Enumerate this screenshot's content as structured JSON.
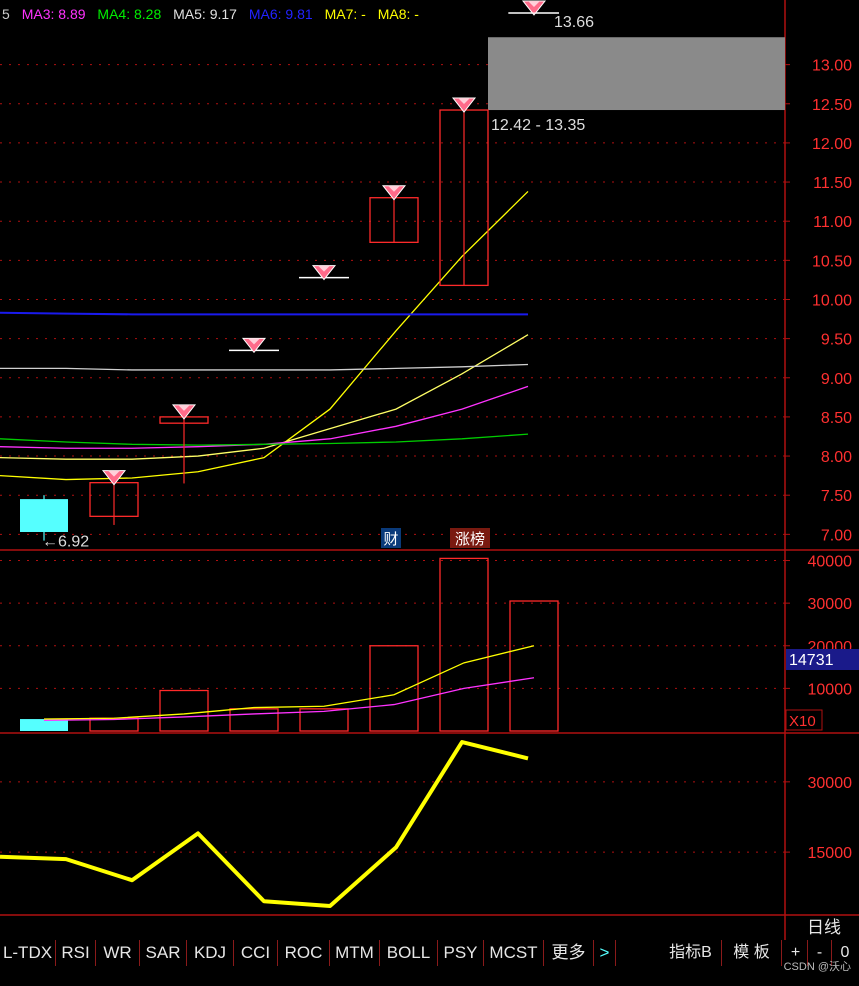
{
  "legend": {
    "left_fragment": "5",
    "items": [
      {
        "name": "MA3",
        "value": "8.89",
        "color": "#ff33ff"
      },
      {
        "name": "MA4",
        "value": "8.28",
        "color": "#00ee00"
      },
      {
        "name": "MA5",
        "value": "9.17",
        "color": "#e0e0e0"
      },
      {
        "name": "MA6",
        "value": "9.81",
        "color": "#2222ff"
      },
      {
        "name": "MA7",
        "value": "-",
        "color": "#ffff00"
      },
      {
        "name": "MA8",
        "value": "-",
        "color": "#ffff00"
      }
    ]
  },
  "colors": {
    "up": "#ff2a2a",
    "down": "#55ffff",
    "grid": "#b01010",
    "ma_fast": "#ffff00",
    "ma_mid": "#ffff66",
    "ma_magenta": "#ff33ff",
    "ma_green": "#00cc00",
    "ma_white": "#cfcfcf",
    "ma_blue": "#1a1aee",
    "highlight_box": "#8a8a8a",
    "indicator": "#ffff00"
  },
  "annotations": {
    "high_label": "13.66",
    "low_label": "6.92",
    "range_label": "12.42 - 13.35",
    "badge_finance": "财",
    "badge_limitup": "涨榜"
  },
  "volume_panel": {
    "current_value": "14731",
    "multiplier": "X10"
  },
  "period_label": "日线",
  "tabs": [
    "L-TDX",
    "RSI",
    "WR",
    "SAR",
    "KDJ",
    "CCI",
    "ROC",
    "MTM",
    "BOLL",
    "PSY",
    "MCST",
    "更多",
    ">"
  ],
  "right_tabs": [
    "指标B",
    "模 板",
    "+",
    "-",
    "0"
  ],
  "watermark": "CSDN @沃心",
  "chart_data": [
    {
      "type": "candlestick",
      "y_ticks": [
        "7.00",
        "7.50",
        "8.00",
        "8.50",
        "9.00",
        "9.50",
        "10.00",
        "10.50",
        "11.00",
        "11.50",
        "12.00",
        "12.50",
        "13.00"
      ],
      "ylim": [
        6.8,
        13.8
      ],
      "candles": [
        {
          "open": 7.45,
          "close": 7.03,
          "high": 7.5,
          "low": 6.92,
          "dir": "down"
        },
        {
          "open": 7.23,
          "close": 7.66,
          "high": 7.66,
          "low": 7.12,
          "dir": "up"
        },
        {
          "open": 8.42,
          "close": 8.5,
          "high": 8.5,
          "low": 7.65,
          "dir": "up"
        },
        {
          "open": 9.35,
          "close": 9.35,
          "high": 9.35,
          "low": 9.35,
          "dir": "up"
        },
        {
          "open": 10.28,
          "close": 10.28,
          "high": 10.28,
          "low": 10.28,
          "dir": "up"
        },
        {
          "open": 10.73,
          "close": 11.3,
          "high": 11.3,
          "low": 10.73,
          "dir": "up"
        },
        {
          "open": 10.18,
          "close": 12.42,
          "high": 12.42,
          "low": 10.18,
          "dir": "up"
        },
        {
          "open": 13.66,
          "close": 13.66,
          "high": 13.66,
          "low": 13.66,
          "dir": "up"
        }
      ],
      "ma_lines": [
        {
          "name": "MA-yellow-fast",
          "values": [
            7.75,
            7.7,
            7.72,
            7.8,
            7.98,
            8.6,
            9.6,
            10.55,
            11.38
          ]
        },
        {
          "name": "MA-yellow-mid",
          "values": [
            7.98,
            7.96,
            7.96,
            8.0,
            8.1,
            8.35,
            8.6,
            9.05,
            9.55
          ]
        },
        {
          "name": "MA3",
          "values": [
            8.12,
            8.1,
            8.1,
            8.12,
            8.15,
            8.22,
            8.38,
            8.6,
            8.89
          ]
        },
        {
          "name": "MA4",
          "values": [
            8.22,
            8.18,
            8.15,
            8.14,
            8.15,
            8.16,
            8.18,
            8.22,
            8.28
          ]
        },
        {
          "name": "MA5",
          "values": [
            9.12,
            9.12,
            9.1,
            9.1,
            9.1,
            9.1,
            9.12,
            9.14,
            9.17
          ]
        },
        {
          "name": "MA6",
          "values": [
            9.83,
            9.82,
            9.81,
            9.81,
            9.81,
            9.81,
            9.81,
            9.81,
            9.81
          ]
        }
      ]
    },
    {
      "type": "bar",
      "y_ticks": [
        "10000",
        "20000",
        "30000",
        "40000"
      ],
      "ylim": [
        0,
        42000
      ],
      "values": [
        2800,
        3000,
        9500,
        5200,
        5200,
        20000,
        40500,
        30500
      ],
      "ma_lines": [
        {
          "name": "VOL-MA-yellow",
          "values": [
            2800,
            3000,
            4000,
            5500,
            5800,
            8500,
            16000,
            20000
          ]
        },
        {
          "name": "VOL-MA-magenta",
          "values": [
            2500,
            2700,
            3300,
            4000,
            4600,
            6200,
            10000,
            12500
          ]
        }
      ]
    },
    {
      "type": "line",
      "y_ticks": [
        "15000",
        "30000"
      ],
      "ylim": [
        2000,
        40000
      ],
      "values": [
        14000,
        13500,
        9000,
        19000,
        4500,
        3500,
        16000,
        38500,
        35000
      ]
    }
  ]
}
